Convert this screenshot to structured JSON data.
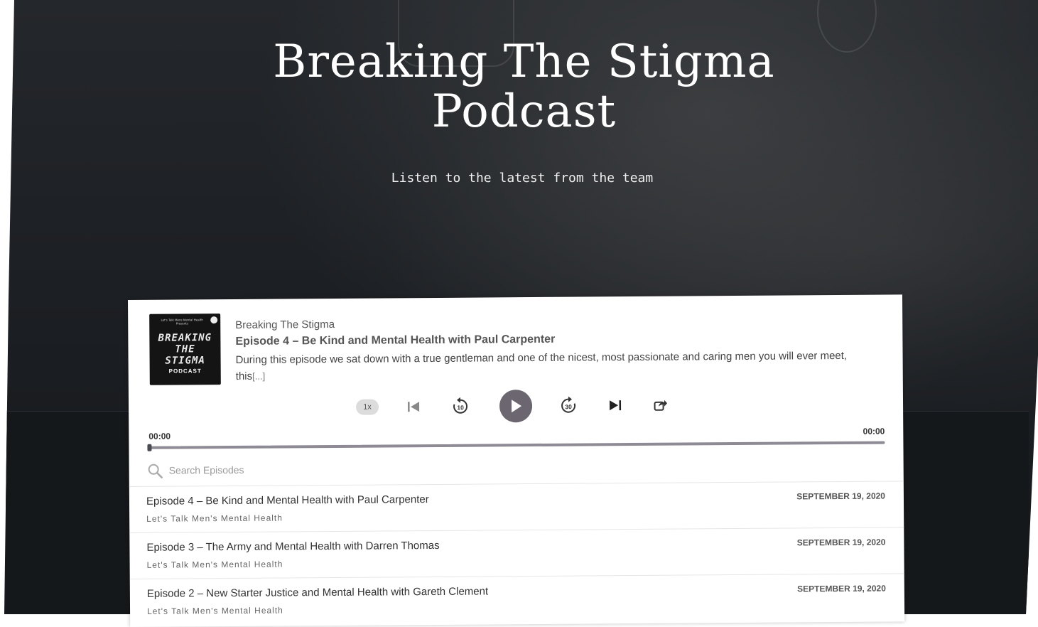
{
  "hero": {
    "title": "Breaking The Stigma Podcast",
    "subtitle": "Listen to the latest from the team"
  },
  "player": {
    "cover": {
      "top_text": "Let's Talk Mens Mental Health Presents",
      "lines": [
        "BREAKING",
        "THE",
        "STIGMA"
      ],
      "bottom_text": "PODCAST"
    },
    "show_name": "Breaking The Stigma",
    "episode_title": "Episode 4 – Be Kind and Mental Health with Paul Carpenter",
    "description": "During this episode we sat down with a true gentleman and one of the nicest, most passionate and caring men you will ever meet, this",
    "read_more": "[...]",
    "speed_label": "1x",
    "rewind_label": "10",
    "forward_label": "30",
    "time_current": "00:00",
    "time_total": "00:00",
    "progress": 0,
    "accent_color": "#6b6670",
    "search_placeholder": "Search Episodes"
  },
  "episodes": [
    {
      "title": "Episode 4 – Be Kind and Mental Health with Paul Carpenter",
      "podcast": "Let's Talk Men's Mental Health",
      "date": "SEPTEMBER 19, 2020"
    },
    {
      "title": "Episode 3 – The Army and Mental Health with Darren Thomas",
      "podcast": "Let's Talk Men's Mental Health",
      "date": "SEPTEMBER 19, 2020"
    },
    {
      "title": "Episode 2 – New Starter Justice and Mental Health with Gareth Clement",
      "podcast": "Let's Talk Men's Mental Health",
      "date": "SEPTEMBER 19, 2020"
    }
  ]
}
